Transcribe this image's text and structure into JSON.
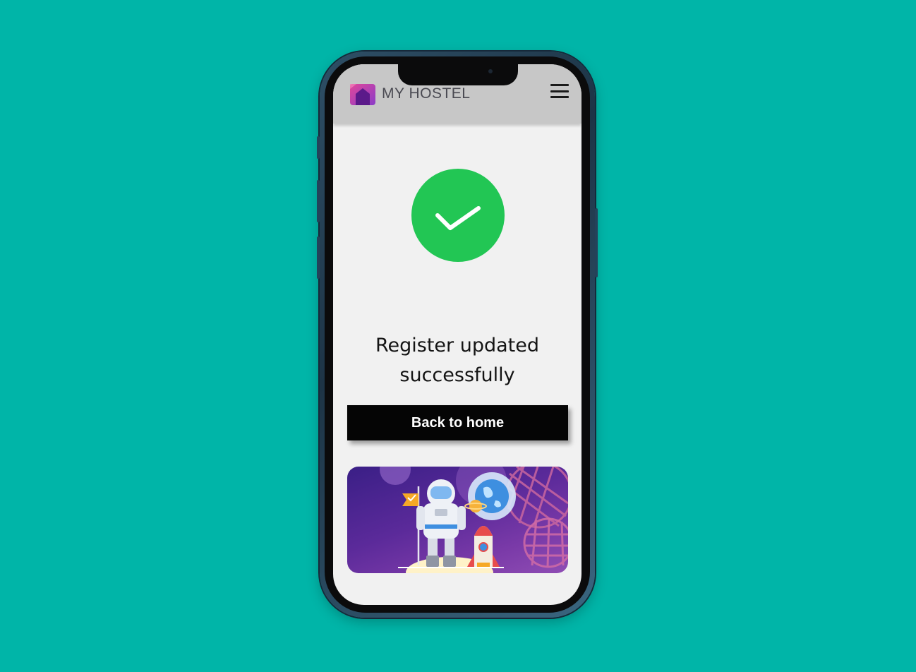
{
  "app": {
    "brand_name": "MY HOSTEL",
    "brand_colors": {
      "gradient_start": "#E0479A",
      "gradient_end": "#6A2CC8",
      "house": "#5B1A8A"
    }
  },
  "header": {
    "menu_icon": "hamburger-menu-icon",
    "background": "#C7C7C7"
  },
  "status": {
    "icon": "checkmark-icon",
    "color": "#22C654",
    "message_line1": "Register updated",
    "message_line2": "successfully"
  },
  "actions": {
    "back_home_label": "Back to home"
  },
  "banner": {
    "illustration": "astronaut-rocket-illustration",
    "background": "#5B2A9A"
  },
  "device": {
    "background": "#00B5A8"
  }
}
